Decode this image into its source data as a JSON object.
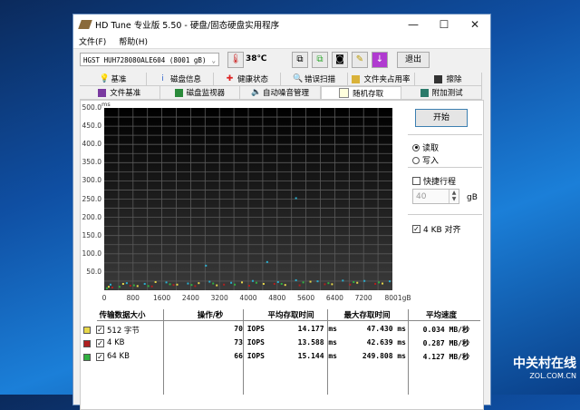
{
  "window": {
    "title": "HD Tune 专业版 5.50 - 硬盘/固态硬盘实用程序",
    "minimize": "—",
    "maximize": "☐",
    "close": "✕"
  },
  "menu": [
    "文件(F)",
    "帮助(H)"
  ],
  "toolbar": {
    "drive": "HGST HUH728080ALE604 (8001 gB)",
    "temperature": "38℃",
    "exit": "退出",
    "icons": [
      "copy-icon",
      "copy-all-icon",
      "camera-icon",
      "options-icon",
      "save-icon"
    ]
  },
  "tabs": {
    "row1": [
      "基准",
      "磁盘信息",
      "健康状态",
      "错误扫描",
      "文件夹占用率",
      "擦除"
    ],
    "row2": [
      "文件基准",
      "磁盘监视器",
      "自动噪音管理",
      "随机存取",
      "附加测试"
    ],
    "active": "随机存取"
  },
  "side": {
    "start": "开始",
    "read": "读取",
    "write": "写入",
    "mode": "read",
    "quick": "快捷行程",
    "quick_checked": false,
    "quick_value": "40",
    "quick_unit": "gB",
    "align": "4 KB 对齐",
    "align_checked": true
  },
  "table": {
    "headers": [
      "传输数据大小",
      "操作/秒",
      "平均存取时间",
      "最大存取时间",
      "平均速度"
    ],
    "rows": [
      {
        "size": "512 字节",
        "color": "#e8d84a",
        "checked": true,
        "iops": "70 IOPS",
        "avg": "14.177 ms",
        "max": "47.430 ms",
        "speed": "0.034 MB/秒"
      },
      {
        "size": "4 KB",
        "color": "#b02020",
        "checked": true,
        "iops": "73 IOPS",
        "avg": "13.588 ms",
        "max": "42.639 ms",
        "speed": "0.287 MB/秒"
      },
      {
        "size": "64 KB",
        "color": "#30b040",
        "checked": true,
        "iops": "66 IOPS",
        "avg": "15.144 ms",
        "max": "249.808 ms",
        "speed": "4.127 MB/秒"
      }
    ]
  },
  "watermark": {
    "brand": "中关村在线",
    "url": "ZOL.COM.CN"
  },
  "chart_data": {
    "type": "scatter",
    "ylabel": "ms",
    "xlabel_unit": "gB",
    "xlim": [
      0,
      8001
    ],
    "ylim": [
      0,
      500
    ],
    "grid": true,
    "yticks": [
      "500.0",
      "450.0",
      "400.0",
      "350.0",
      "300.0",
      "250.0",
      "200.0",
      "150.0",
      "100.0",
      "50.0"
    ],
    "xticks": [
      "0",
      "800",
      "1600",
      "2400",
      "3200",
      "4000",
      "4800",
      "5600",
      "6400",
      "7200",
      "8001gB"
    ],
    "series": [
      {
        "name": "512 字节",
        "color": "#e8d84a",
        "points": [
          [
            100,
            12
          ],
          [
            500,
            20
          ],
          [
            900,
            14
          ],
          [
            1400,
            25
          ],
          [
            2000,
            18
          ],
          [
            2600,
            22
          ],
          [
            3100,
            16
          ],
          [
            3800,
            24
          ],
          [
            4400,
            20
          ],
          [
            5000,
            17
          ],
          [
            5700,
            26
          ],
          [
            6300,
            19
          ],
          [
            7000,
            23
          ],
          [
            7700,
            21
          ]
        ]
      },
      {
        "name": "4 KB",
        "color": "#b02020",
        "points": [
          [
            200,
            10
          ],
          [
            700,
            15
          ],
          [
            1300,
            13
          ],
          [
            1900,
            17
          ],
          [
            2500,
            14
          ],
          [
            3300,
            18
          ],
          [
            4000,
            15
          ],
          [
            4700,
            20
          ],
          [
            5400,
            16
          ],
          [
            6100,
            19
          ],
          [
            6800,
            18
          ],
          [
            7500,
            20
          ]
        ]
      },
      {
        "name": "64 KB",
        "color": "#30b040",
        "points": [
          [
            50,
            8
          ],
          [
            400,
            12
          ],
          [
            800,
            16
          ],
          [
            1200,
            14
          ],
          [
            1800,
            19
          ],
          [
            2400,
            17
          ],
          [
            3000,
            21
          ],
          [
            3600,
            18
          ],
          [
            4200,
            23
          ],
          [
            4900,
            20
          ],
          [
            5500,
            24
          ],
          [
            6200,
            22
          ],
          [
            6900,
            25
          ],
          [
            7600,
            24
          ]
        ]
      },
      {
        "color": "#2ab0d0",
        "points": [
          [
            150,
            18
          ],
          [
            600,
            22
          ],
          [
            1100,
            20
          ],
          [
            1700,
            24
          ],
          [
            2300,
            21
          ],
          [
            2900,
            26
          ],
          [
            3500,
            23
          ],
          [
            4100,
            28
          ],
          [
            4800,
            25
          ],
          [
            5300,
            30
          ],
          [
            5900,
            27
          ],
          [
            6600,
            29
          ],
          [
            7200,
            28
          ],
          [
            7900,
            27
          ],
          [
            4500,
            80
          ],
          [
            2800,
            70
          ],
          [
            5300,
            255
          ]
        ]
      }
    ]
  }
}
